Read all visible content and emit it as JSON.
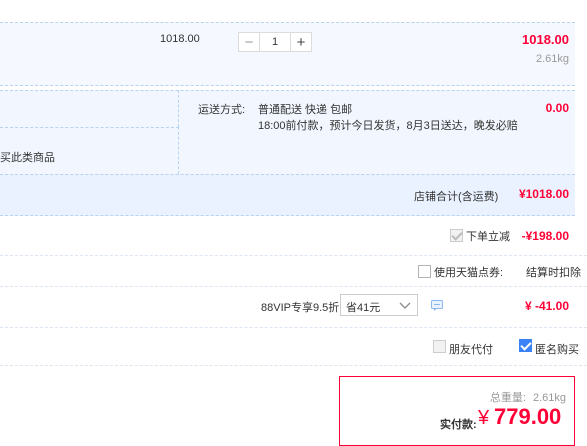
{
  "item": {
    "unit_price": "1018.00",
    "quantity": "1",
    "minus_symbol": "−",
    "plus_symbol": "+",
    "subtotal": "1018.00",
    "weight": "2.61kg"
  },
  "shipping": {
    "label": "运送方式:",
    "method": "普通配送 快递 包邮",
    "note": "18:00前付款，预计今日发货，8月3日送达，晚发必赔",
    "fee": "0.00",
    "left_note": "买此类商品"
  },
  "shop_total": {
    "label": "店铺合计(含运费)",
    "value": "¥1018.00"
  },
  "discount": {
    "label": "下单立减",
    "value": "-¥198.00"
  },
  "points": {
    "label": "使用天猫点券:",
    "right_text": "结算时扣除"
  },
  "vip": {
    "label": "88VIP专享9.5折",
    "select_value": "省41元",
    "value": "¥ -41.00"
  },
  "options": {
    "friend_pay": "朋友代付",
    "anonymous": "匿名购买"
  },
  "summary": {
    "weight_label": "总重量:",
    "weight_value": "2.61kg",
    "pay_label": "实付款:",
    "currency": "¥",
    "pay_value": "779.00"
  },
  "colors": {
    "accent_red": "#ff0036",
    "panel_blue": "#f2f7ff",
    "dashed_border": "#b9d3ee",
    "checkbox_blue": "#3b82f6"
  }
}
